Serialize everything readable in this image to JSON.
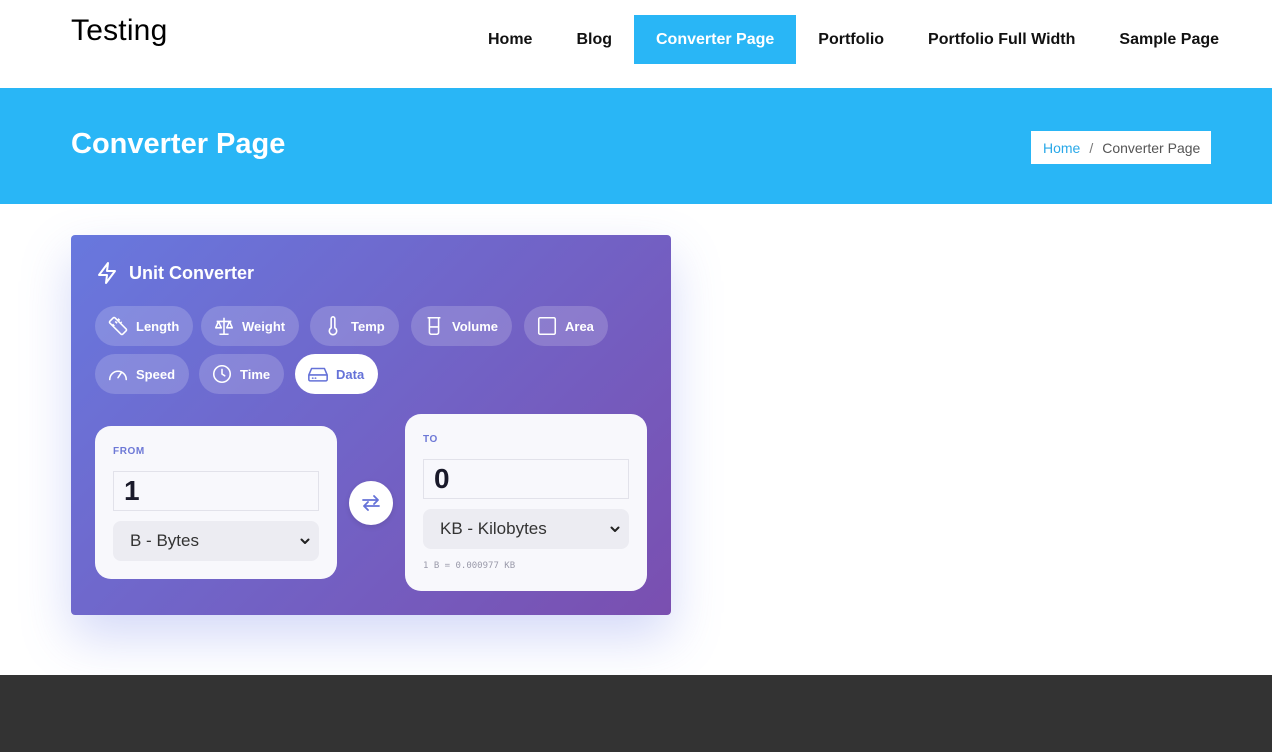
{
  "site": {
    "title": "Testing"
  },
  "nav": {
    "items": [
      {
        "label": "Home"
      },
      {
        "label": "Blog"
      },
      {
        "label": "Converter Page"
      },
      {
        "label": "Portfolio"
      },
      {
        "label": "Portfolio Full Width"
      },
      {
        "label": "Sample Page"
      }
    ],
    "active": "Converter Page"
  },
  "banner": {
    "title": "Converter Page",
    "breadcrumb": {
      "home": "Home",
      "separator": "/",
      "current": "Converter Page"
    }
  },
  "converter": {
    "title": "Unit Converter",
    "title_icon": "lightning-icon",
    "categories": [
      {
        "label": "Length",
        "icon": "ruler-icon"
      },
      {
        "label": "Weight",
        "icon": "scale-icon"
      },
      {
        "label": "Temp",
        "icon": "thermometer-icon"
      },
      {
        "label": "Volume",
        "icon": "beaker-icon"
      },
      {
        "label": "Area",
        "icon": "square-icon"
      },
      {
        "label": "Speed",
        "icon": "speedometer-icon"
      },
      {
        "label": "Time",
        "icon": "clock-icon"
      },
      {
        "label": "Data",
        "icon": "hard-drive-icon"
      }
    ],
    "active_category": "Data",
    "from": {
      "label": "FROM",
      "value": "1",
      "unit": "B - Bytes"
    },
    "to": {
      "label": "TO",
      "value": "0",
      "unit": "KB - Kilobytes",
      "formula": "1 B = 0.000977 KB"
    },
    "swap_icon": "swap-arrows-icon"
  },
  "colors": {
    "accent": "#29b6f6",
    "card_gradient_start": "#6878de",
    "card_gradient_end": "#7a4fb0",
    "footer": "#333333"
  }
}
